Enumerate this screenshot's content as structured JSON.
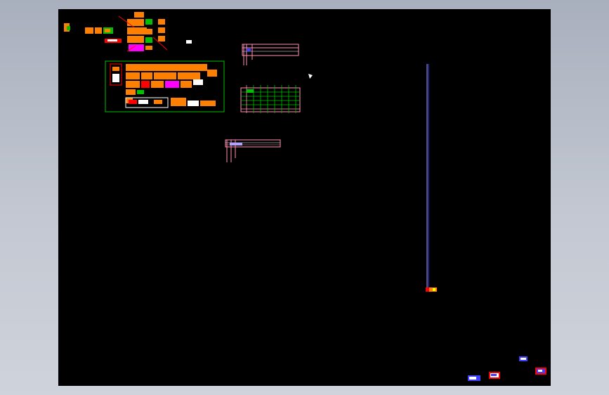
{
  "viewport": {
    "background": "#000000",
    "frame_background": "#b8bec9"
  },
  "palette": {
    "orange": "#ff7f00",
    "red": "#ff0000",
    "green": "#00c000",
    "magenta": "#ff00ff",
    "blue": "#3f3fff",
    "white": "#ffffff",
    "pink": "#ff8fb0",
    "yellow": "#ffff00",
    "violet": "#b0a0ff"
  }
}
